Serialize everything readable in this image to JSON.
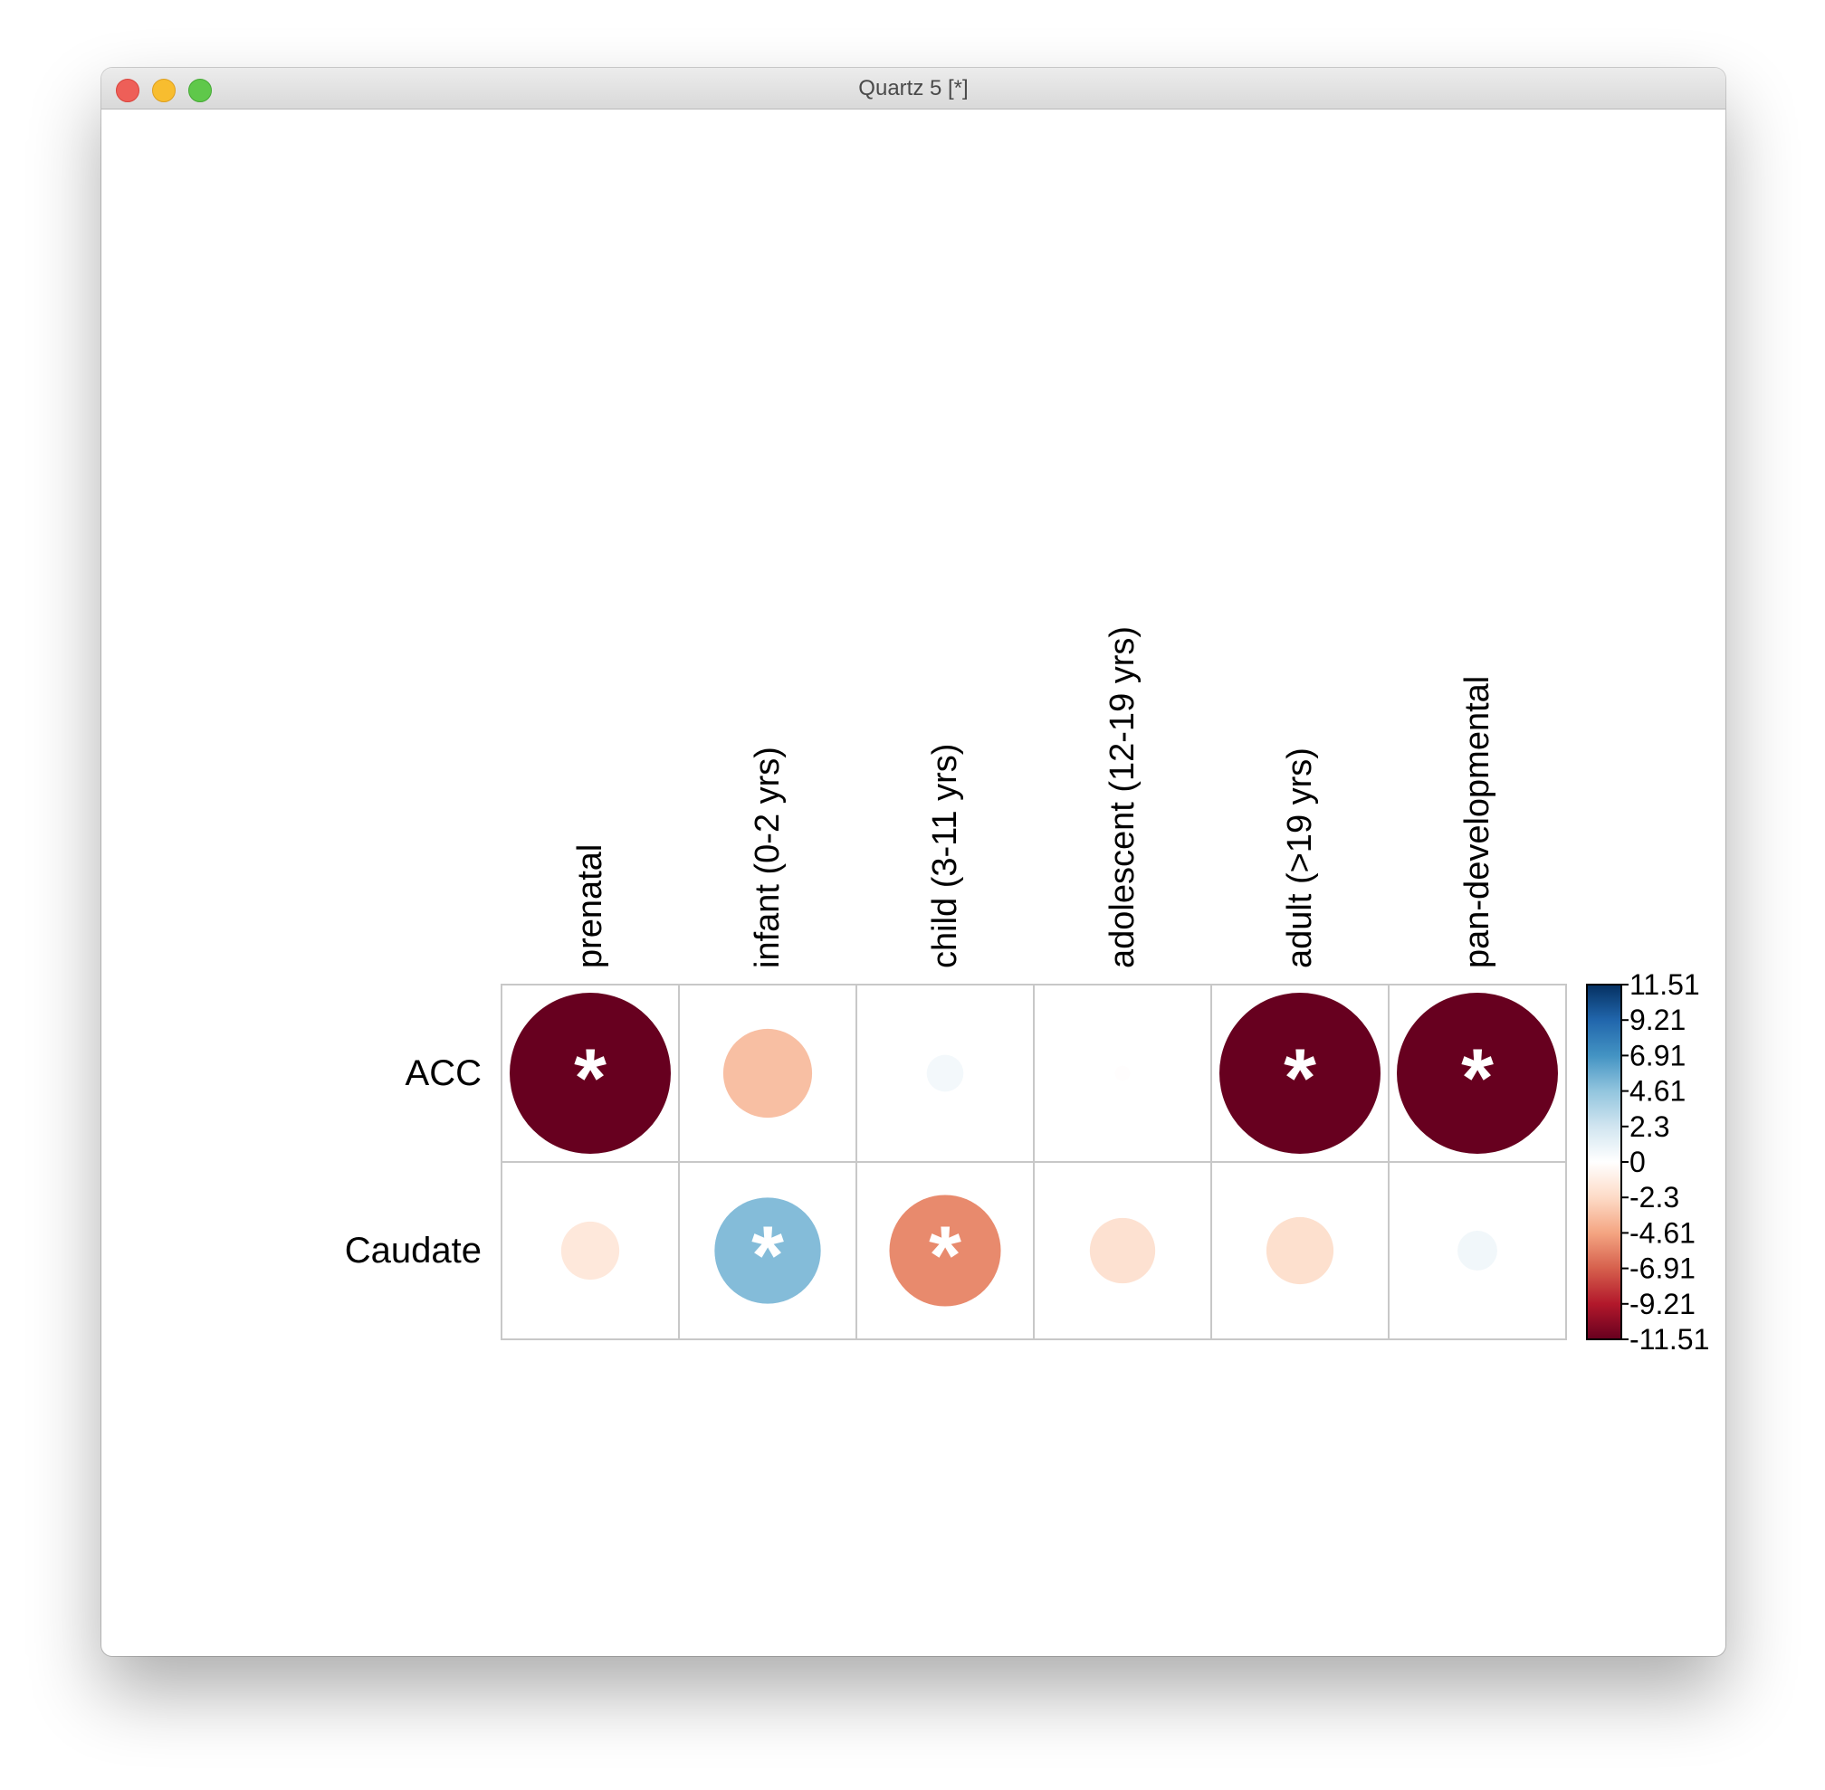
{
  "window": {
    "title": "Quartz 5 [*]"
  },
  "chart_data": {
    "type": "heatmap",
    "style": "corrplot-circle",
    "columns": [
      "prenatal",
      "infant (0-2 yrs)",
      "child (3-11 yrs)",
      "adolescent (12-19 yrs)",
      "adult (>19 yrs)",
      "pan-developmental"
    ],
    "rows": [
      "ACC",
      "Caudate"
    ],
    "values": [
      [
        -11.51,
        -3.5,
        0.6,
        -0.1,
        -11.51,
        -11.51
      ],
      [
        -1.5,
        5.0,
        -5.5,
        -1.9,
        -2.0,
        0.7
      ]
    ],
    "significant": [
      [
        true,
        false,
        false,
        false,
        true,
        true
      ],
      [
        false,
        true,
        true,
        false,
        false,
        false
      ]
    ],
    "marker": "*",
    "colorbar": {
      "ticks": [
        "11.51",
        "9.21",
        "6.91",
        "4.61",
        "2.3",
        "0",
        "-2.3",
        "-4.61",
        "-6.91",
        "-9.21",
        "-11.51"
      ],
      "range": [
        -11.51,
        11.51
      ],
      "palette": [
        "#67001f",
        "#b2182b",
        "#d6604d",
        "#f4a582",
        "#fddbc7",
        "#ffffff",
        "#d1e5f0",
        "#92c5de",
        "#4393c3",
        "#2166ac",
        "#053061"
      ]
    },
    "grid": true,
    "legend_position": "right"
  }
}
